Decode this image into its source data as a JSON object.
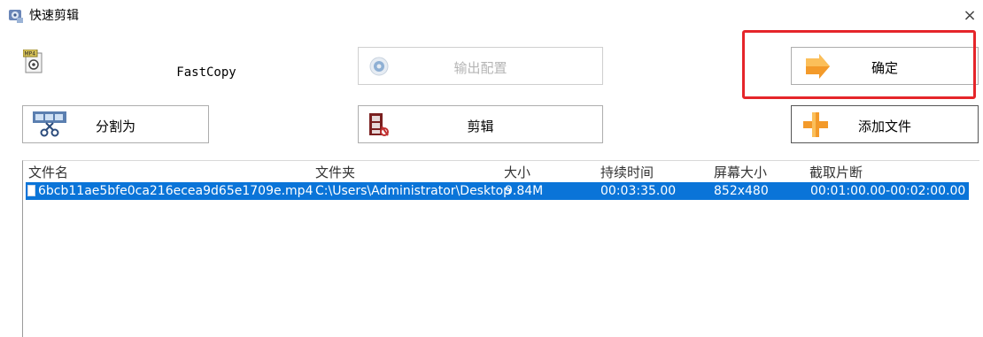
{
  "window": {
    "title": "快速剪辑",
    "close_glyph": "×"
  },
  "top": {
    "fastcopy_label": "FastCopy",
    "output_config_label": "输出配置",
    "confirm_label": "确定"
  },
  "actions": {
    "split_label": "分割为",
    "edit_label": "剪辑",
    "add_file_label": "添加文件"
  },
  "file_list": {
    "columns": [
      "文件名",
      "文件夹",
      "大小",
      "持续时间",
      "屏幕大小",
      "截取片断"
    ],
    "rows": [
      {
        "name": "6bcb11ae5bfe0ca216ecea9d65e1709e.mp4",
        "folder": "C:\\Users\\Administrator\\Desktop",
        "size": "9.84M",
        "duration": "00:03:35.00",
        "resolution": "852x480",
        "segment": "00:01:00.00-00:02:00.00",
        "selected": true
      }
    ]
  },
  "colors": {
    "highlight": "#e5252a",
    "selection": "#0a74d8"
  },
  "icons": [
    "app-icon",
    "mp4-file-icon",
    "gear-disc-icon",
    "orange-arrow-icon",
    "film-scissors-icon",
    "film-edit-icon",
    "orange-plus-icon",
    "video-file-icon"
  ]
}
